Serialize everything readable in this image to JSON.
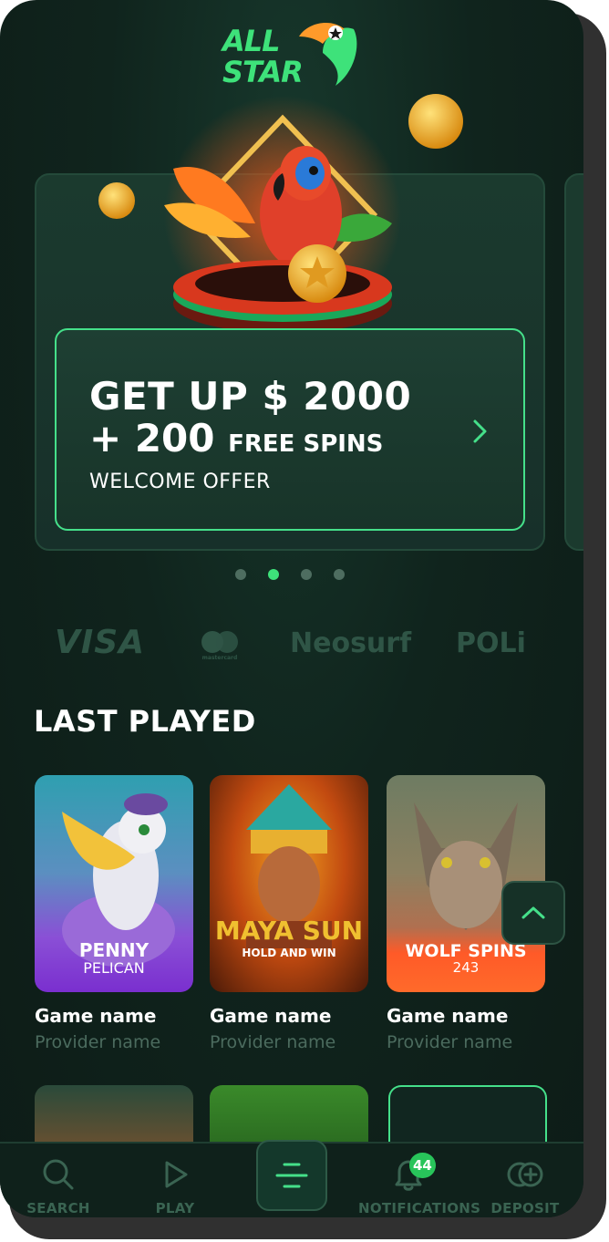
{
  "brand": {
    "logo_line1": "ALL",
    "logo_line2": "STAR"
  },
  "banner": {
    "headline_line1": "GET UP $ 2000",
    "headline_line2_big": "+ 200",
    "headline_line2_small": "FREE SPINS",
    "subtitle": "WELCOME OFFER",
    "slide_count": 4,
    "active_slide": 2
  },
  "payments": {
    "visa": "VISA",
    "mastercard": "mastercard",
    "neosurf": "Neosurf",
    "poli": "POLi"
  },
  "last_played": {
    "title": "LAST PLAYED",
    "games": [
      {
        "name": "Game name",
        "provider": "Provider name",
        "art_title": "PENNY",
        "art_subtitle": "PELICAN"
      },
      {
        "name": "Game name",
        "provider": "Provider name",
        "art_title": "MAYA SUN",
        "art_subtitle": "HOLD AND WIN"
      },
      {
        "name": "Game name",
        "provider": "Provider name",
        "art_title": "WOLF SPINS",
        "art_subtitle": "243"
      }
    ]
  },
  "nav": {
    "search": "SEARCH",
    "play": "PLAY",
    "notifications": "NOTIFICATIONS",
    "notification_count": "44",
    "deposit": "DEPOSIT"
  },
  "colors": {
    "accent": "#3ee27a",
    "background": "#10241d",
    "muted": "#4b6b5e"
  }
}
